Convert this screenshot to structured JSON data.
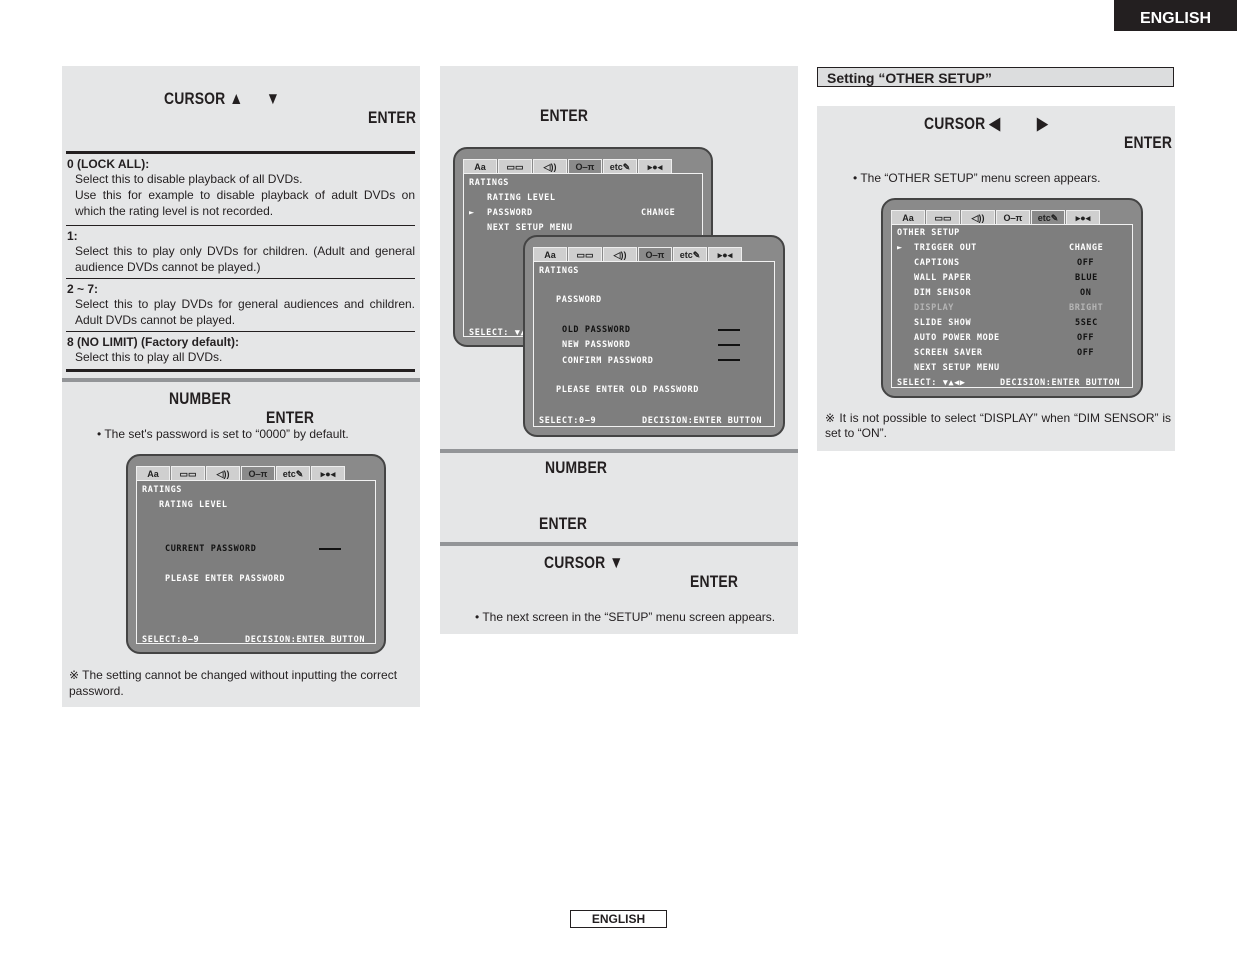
{
  "header": {
    "language_tab": "ENGLISH"
  },
  "footer": {
    "language_label": "ENGLISH"
  },
  "left_column": {
    "step1": {
      "cursor_label": "CURSOR ▲",
      "cursor_down": "▼",
      "enter_label": "ENTER"
    },
    "options": [
      {
        "title": "0 (LOCK ALL):",
        "lines": [
          "Select this to disable playback of all DVDs.",
          "Use this for example to disable playback of adult DVDs on which the rating level is not recorded."
        ]
      },
      {
        "title": "1:",
        "lines": [
          "Select this to play only DVDs for children. (Adult and general audience DVDs cannot be played.)"
        ]
      },
      {
        "title": "2 ~ 7:",
        "lines": [
          "Select this to play DVDs for general audiences and children. Adult DVDs cannot be played."
        ]
      },
      {
        "title": "8 (NO LIMIT) (Factory default):",
        "lines": [
          "Select this to play all DVDs."
        ]
      }
    ],
    "step2": {
      "number_label": "NUMBER",
      "enter_label": "ENTER",
      "note": "• The set's password is set to “0000” by default."
    },
    "osd": {
      "tabs": [
        "Aa",
        "▭▭",
        "◁))",
        "O‒π",
        "etc✎",
        "▸●◂"
      ],
      "title": "RATINGS",
      "subtitle": "RATING LEVEL",
      "current_password_label": "CURRENT PASSWORD",
      "prompt": "PLEASE ENTER PASSWORD",
      "select_hint": "SELECT:0−9",
      "decision_hint": "DECISION:ENTER BUTTON"
    },
    "footnote": "※ The setting cannot be changed without inputting the correct password."
  },
  "middle_column": {
    "step1": {
      "enter_label": "ENTER"
    },
    "osd_back": {
      "title": "RATINGS",
      "items": [
        {
          "label": "RATING LEVEL",
          "value": "",
          "selected": false
        },
        {
          "label": "PASSWORD",
          "value": "CHANGE",
          "selected": true
        },
        {
          "label": "NEXT SETUP MENU",
          "value": "",
          "selected": false
        }
      ],
      "select_hint": "SELECT: ▼▲"
    },
    "osd_front": {
      "title": "RATINGS",
      "subtitle": "PASSWORD",
      "fields": [
        "OLD PASSWORD",
        "NEW PASSWORD",
        "CONFIRM PASSWORD"
      ],
      "prompt": "PLEASE ENTER OLD PASSWORD",
      "select_hint": "SELECT:0−9",
      "decision_hint": "DECISION:ENTER BUTTON"
    },
    "step2": {
      "number_label": "NUMBER",
      "enter_label": "ENTER"
    },
    "step3": {
      "cursor_label": "CURSOR ▼",
      "enter_label": "ENTER",
      "note": "• The next screen in the “SETUP” menu screen appears."
    }
  },
  "right_column": {
    "section_title": "Setting “OTHER SETUP”",
    "step1": {
      "cursor_label": "CURSOR ◀",
      "cursor_right": "▶",
      "enter_label": "ENTER",
      "note": "• The “OTHER SETUP” menu screen appears."
    },
    "osd": {
      "title": "OTHER SETUP",
      "items": [
        {
          "label": "TRIGGER OUT",
          "value": "CHANGE",
          "selected": true,
          "disabled": false
        },
        {
          "label": "CAPTIONS",
          "value": "OFF",
          "selected": false,
          "disabled": false
        },
        {
          "label": "WALL PAPER",
          "value": "BLUE",
          "selected": false,
          "disabled": false
        },
        {
          "label": "DIM SENSOR",
          "value": "ON",
          "selected": false,
          "disabled": false
        },
        {
          "label": "DISPLAY",
          "value": "BRIGHT",
          "selected": false,
          "disabled": true
        },
        {
          "label": "SLIDE SHOW",
          "value": "5SEC",
          "selected": false,
          "disabled": false
        },
        {
          "label": "AUTO POWER MODE",
          "value": "OFF",
          "selected": false,
          "disabled": false
        },
        {
          "label": "SCREEN SAVER",
          "value": "OFF",
          "selected": false,
          "disabled": false
        },
        {
          "label": "NEXT SETUP MENU",
          "value": "",
          "selected": false,
          "disabled": false
        }
      ],
      "select_hint": "SELECT: ▼▲◀▶",
      "decision_hint": "DECISION:ENTER BUTTON"
    },
    "footnote": "※ It is not possible to select “DISPLAY” when “DIM SENSOR” is set to “ON”."
  }
}
